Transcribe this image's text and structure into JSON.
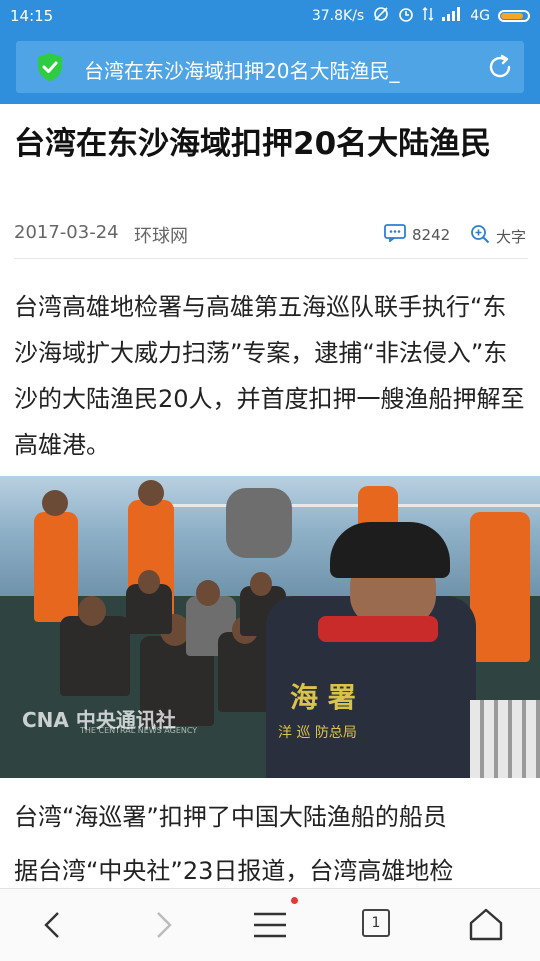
{
  "status_bar": {
    "time": "14:15",
    "network_speed": "37.8K/s",
    "network_type": "4G",
    "battery_color": "#f5a623",
    "battery_level": 0.85
  },
  "browser": {
    "url_title": "台湾在东沙海域扣押20名大陆渔民_",
    "security_icon": "shield-check-icon",
    "reload_icon": "reload-icon",
    "accent_color": "#2f8fdc"
  },
  "article": {
    "title": "台湾在东沙海域扣押20名大陆渔民",
    "date": "2017-03-24",
    "source": "环球网",
    "comment_count": "8242",
    "font_size_label": "大字",
    "paragraph1": "台湾高雄地检署与高雄第五海巡队联手执行“东沙海域扩大威力扫荡”专案，逮捕“非法侵入”东沙的大陆渔民20人，并首度扣押一艘渔船押解至高雄港。",
    "image_watermark": "CNA 中央通讯社",
    "image_watermark_sub": "THE CENTRAL NEWS AGENCY",
    "image_vest_text_main": "海  署",
    "image_vest_text_sub": "洋 巡 防总局",
    "paragraph2": "台湾“海巡署”扣押了中国大陆渔船的船员",
    "paragraph3": "据台湾“中央社”23日报道，台湾高雄地检"
  },
  "bottom_nav": {
    "tab_count": "1",
    "back_icon": "back-chevron-icon",
    "forward_icon": "forward-chevron-icon",
    "menu_icon": "menu-icon",
    "home_icon": "home-icon",
    "notification_dot_color": "#e53935"
  }
}
